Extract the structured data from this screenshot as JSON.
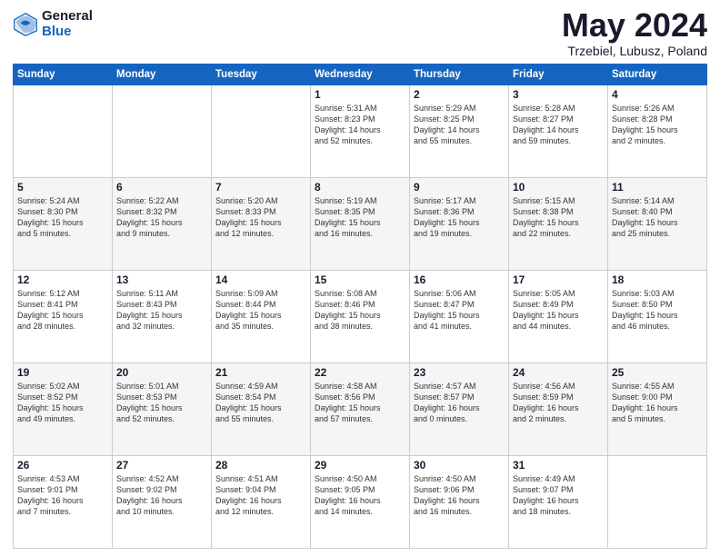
{
  "header": {
    "logo_general": "General",
    "logo_blue": "Blue",
    "title": "May 2024",
    "location": "Trzebiel, Lubusz, Poland"
  },
  "weekdays": [
    "Sunday",
    "Monday",
    "Tuesday",
    "Wednesday",
    "Thursday",
    "Friday",
    "Saturday"
  ],
  "weeks": [
    [
      {
        "day": "",
        "info": ""
      },
      {
        "day": "",
        "info": ""
      },
      {
        "day": "",
        "info": ""
      },
      {
        "day": "1",
        "info": "Sunrise: 5:31 AM\nSunset: 8:23 PM\nDaylight: 14 hours\nand 52 minutes."
      },
      {
        "day": "2",
        "info": "Sunrise: 5:29 AM\nSunset: 8:25 PM\nDaylight: 14 hours\nand 55 minutes."
      },
      {
        "day": "3",
        "info": "Sunrise: 5:28 AM\nSunset: 8:27 PM\nDaylight: 14 hours\nand 59 minutes."
      },
      {
        "day": "4",
        "info": "Sunrise: 5:26 AM\nSunset: 8:28 PM\nDaylight: 15 hours\nand 2 minutes."
      }
    ],
    [
      {
        "day": "5",
        "info": "Sunrise: 5:24 AM\nSunset: 8:30 PM\nDaylight: 15 hours\nand 5 minutes."
      },
      {
        "day": "6",
        "info": "Sunrise: 5:22 AM\nSunset: 8:32 PM\nDaylight: 15 hours\nand 9 minutes."
      },
      {
        "day": "7",
        "info": "Sunrise: 5:20 AM\nSunset: 8:33 PM\nDaylight: 15 hours\nand 12 minutes."
      },
      {
        "day": "8",
        "info": "Sunrise: 5:19 AM\nSunset: 8:35 PM\nDaylight: 15 hours\nand 16 minutes."
      },
      {
        "day": "9",
        "info": "Sunrise: 5:17 AM\nSunset: 8:36 PM\nDaylight: 15 hours\nand 19 minutes."
      },
      {
        "day": "10",
        "info": "Sunrise: 5:15 AM\nSunset: 8:38 PM\nDaylight: 15 hours\nand 22 minutes."
      },
      {
        "day": "11",
        "info": "Sunrise: 5:14 AM\nSunset: 8:40 PM\nDaylight: 15 hours\nand 25 minutes."
      }
    ],
    [
      {
        "day": "12",
        "info": "Sunrise: 5:12 AM\nSunset: 8:41 PM\nDaylight: 15 hours\nand 28 minutes."
      },
      {
        "day": "13",
        "info": "Sunrise: 5:11 AM\nSunset: 8:43 PM\nDaylight: 15 hours\nand 32 minutes."
      },
      {
        "day": "14",
        "info": "Sunrise: 5:09 AM\nSunset: 8:44 PM\nDaylight: 15 hours\nand 35 minutes."
      },
      {
        "day": "15",
        "info": "Sunrise: 5:08 AM\nSunset: 8:46 PM\nDaylight: 15 hours\nand 38 minutes."
      },
      {
        "day": "16",
        "info": "Sunrise: 5:06 AM\nSunset: 8:47 PM\nDaylight: 15 hours\nand 41 minutes."
      },
      {
        "day": "17",
        "info": "Sunrise: 5:05 AM\nSunset: 8:49 PM\nDaylight: 15 hours\nand 44 minutes."
      },
      {
        "day": "18",
        "info": "Sunrise: 5:03 AM\nSunset: 8:50 PM\nDaylight: 15 hours\nand 46 minutes."
      }
    ],
    [
      {
        "day": "19",
        "info": "Sunrise: 5:02 AM\nSunset: 8:52 PM\nDaylight: 15 hours\nand 49 minutes."
      },
      {
        "day": "20",
        "info": "Sunrise: 5:01 AM\nSunset: 8:53 PM\nDaylight: 15 hours\nand 52 minutes."
      },
      {
        "day": "21",
        "info": "Sunrise: 4:59 AM\nSunset: 8:54 PM\nDaylight: 15 hours\nand 55 minutes."
      },
      {
        "day": "22",
        "info": "Sunrise: 4:58 AM\nSunset: 8:56 PM\nDaylight: 15 hours\nand 57 minutes."
      },
      {
        "day": "23",
        "info": "Sunrise: 4:57 AM\nSunset: 8:57 PM\nDaylight: 16 hours\nand 0 minutes."
      },
      {
        "day": "24",
        "info": "Sunrise: 4:56 AM\nSunset: 8:59 PM\nDaylight: 16 hours\nand 2 minutes."
      },
      {
        "day": "25",
        "info": "Sunrise: 4:55 AM\nSunset: 9:00 PM\nDaylight: 16 hours\nand 5 minutes."
      }
    ],
    [
      {
        "day": "26",
        "info": "Sunrise: 4:53 AM\nSunset: 9:01 PM\nDaylight: 16 hours\nand 7 minutes."
      },
      {
        "day": "27",
        "info": "Sunrise: 4:52 AM\nSunset: 9:02 PM\nDaylight: 16 hours\nand 10 minutes."
      },
      {
        "day": "28",
        "info": "Sunrise: 4:51 AM\nSunset: 9:04 PM\nDaylight: 16 hours\nand 12 minutes."
      },
      {
        "day": "29",
        "info": "Sunrise: 4:50 AM\nSunset: 9:05 PM\nDaylight: 16 hours\nand 14 minutes."
      },
      {
        "day": "30",
        "info": "Sunrise: 4:50 AM\nSunset: 9:06 PM\nDaylight: 16 hours\nand 16 minutes."
      },
      {
        "day": "31",
        "info": "Sunrise: 4:49 AM\nSunset: 9:07 PM\nDaylight: 16 hours\nand 18 minutes."
      },
      {
        "day": "",
        "info": ""
      }
    ]
  ]
}
